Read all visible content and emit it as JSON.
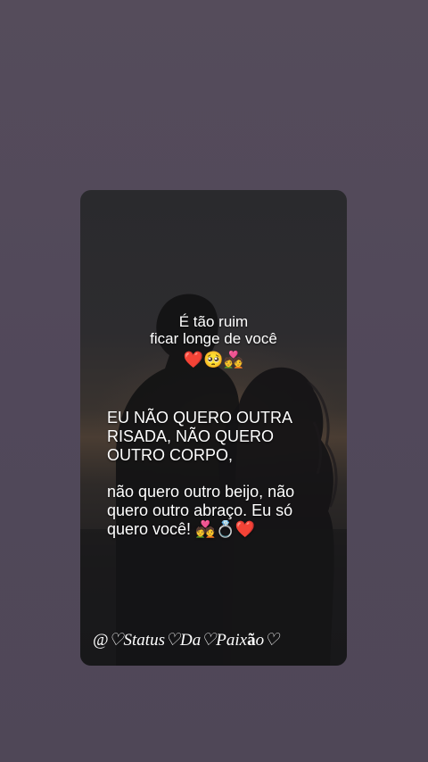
{
  "story": {
    "caption_top": {
      "line1": "É tão ruim",
      "line2": "ficar longe de você",
      "emojis": "❤️🥺💑"
    },
    "shout": {
      "line1": "EU NÃO QUERO OUTRA",
      "line2": "RISADA, NÃO QUERO",
      "line3": "OUTRO CORPO,"
    },
    "soft": {
      "line1": "não quero outro beijo, não",
      "line2": "quero outro abraço. Eu só",
      "line3": "quero você! 💑💍❤️"
    },
    "signature": {
      "prefix": "@♡Status♡Da♡Paix",
      "bold": "ã",
      "suffix": "o♡"
    }
  },
  "colors": {
    "page_background": "#554c5b",
    "card_background": "#1f1e20",
    "text": "#ffffff"
  }
}
